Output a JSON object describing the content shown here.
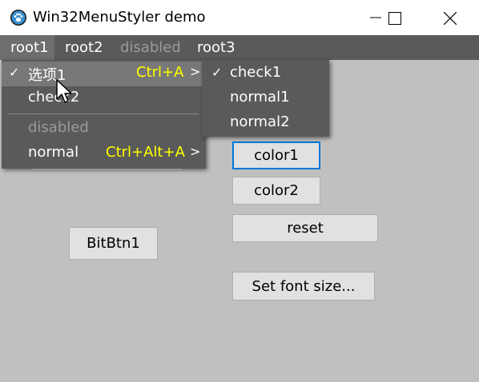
{
  "window": {
    "title": "Win32MenuStyler demo",
    "icon": "paw-icon"
  },
  "menubar": {
    "items": [
      {
        "label": "root1",
        "disabled": false
      },
      {
        "label": "root2",
        "disabled": false
      },
      {
        "label": "disabled",
        "disabled": true
      },
      {
        "label": "root3",
        "disabled": false
      }
    ]
  },
  "root1_menu": {
    "items": [
      {
        "check": "✓",
        "label": "选项1",
        "shortcut": "Ctrl+A",
        "arrow": ">"
      },
      {
        "check": "",
        "label": "check2",
        "shortcut": "",
        "arrow": ""
      },
      {
        "check": "",
        "label": "disabled",
        "shortcut": "",
        "arrow": ""
      },
      {
        "check": "",
        "label": "normal",
        "shortcut": "Ctrl+Alt+A",
        "arrow": ">"
      }
    ]
  },
  "submenu": {
    "items": [
      {
        "check": "✓",
        "label": "check1"
      },
      {
        "check": "",
        "label": "normal1"
      },
      {
        "check": "",
        "label": "normal2"
      }
    ]
  },
  "buttons": {
    "color1": "color1",
    "color2": "color2",
    "reset": "reset",
    "set_font_size": "Set font size...",
    "bitbtn1": "BitBtn1"
  },
  "colors": {
    "menu_bg": "#5a5a5a",
    "highlight": "#787878",
    "shortcut": "#ffff00",
    "disabled": "#9a9a9a",
    "focus": "#0078d7"
  }
}
